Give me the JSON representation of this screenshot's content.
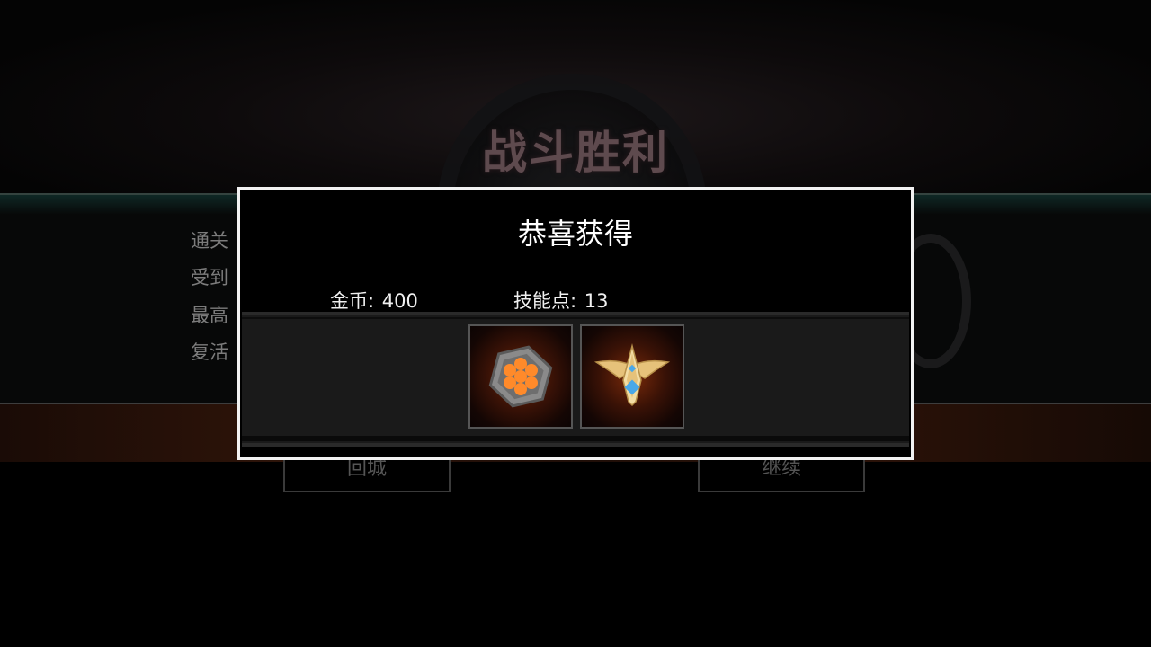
{
  "background": {
    "victory_title": "战斗胜利",
    "stats": [
      "通关",
      "受到",
      "最高",
      "复活"
    ],
    "buttons": {
      "return_city": "回城",
      "continue": "继续"
    }
  },
  "dialog": {
    "title": "恭喜获得",
    "rewards": {
      "gold_label": "金币",
      "gold_value": "400",
      "skill_points_label": "技能点",
      "skill_points_value": "13"
    },
    "items": [
      {
        "icon": "hexagon-orb-icon"
      },
      {
        "icon": "golden-star-wing-icon"
      }
    ]
  },
  "colors": {
    "dialog_border": "#f2f2f2",
    "item_glow": "#7a2a0a",
    "accent_gold": "#e6c27a",
    "accent_blue": "#4aa8e8"
  }
}
